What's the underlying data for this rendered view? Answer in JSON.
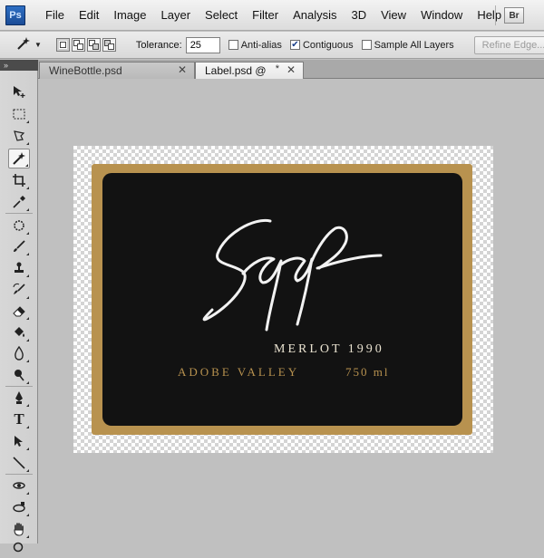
{
  "app": {
    "logo": "Ps",
    "bridge_button": "Br"
  },
  "menu": [
    "File",
    "Edit",
    "Image",
    "Layer",
    "Select",
    "Filter",
    "Analysis",
    "3D",
    "View",
    "Window",
    "Help"
  ],
  "options": {
    "tool_icon": "magic-wand-icon",
    "tolerance_label": "Tolerance:",
    "tolerance_value": "25",
    "anti_alias_label": "Anti-alias",
    "anti_alias_checked": false,
    "contiguous_label": "Contiguous",
    "contiguous_checked": true,
    "sample_all_label": "Sample All Layers",
    "sample_all_checked": false,
    "refine_edge_label": "Refine Edge..."
  },
  "tabs": [
    {
      "label": "WineBottle.psd",
      "active": false
    },
    {
      "label": "Label.psd @",
      "active": true,
      "modified": "*"
    }
  ],
  "toolbox": {
    "header": "»",
    "tools": [
      "move",
      "marquee",
      "lasso",
      "magic-wand",
      "crop",
      "eyedropper",
      "spot-healing",
      "brush",
      "clone-stamp",
      "history-brush",
      "eraser",
      "paint-bucket",
      "blur",
      "dodge",
      "pen",
      "type",
      "path-selection",
      "line",
      "3d-rotate",
      "3d-orbit",
      "hand",
      "zoom"
    ],
    "active": "magic-wand"
  },
  "document": {
    "wine": "MERLOT 1990",
    "valley": "ADOBE VALLEY",
    "volume": "750 ml"
  },
  "colors": {
    "label_gold": "#b8924f",
    "label_black": "#121212",
    "cream_text": "#e9e2d0"
  }
}
